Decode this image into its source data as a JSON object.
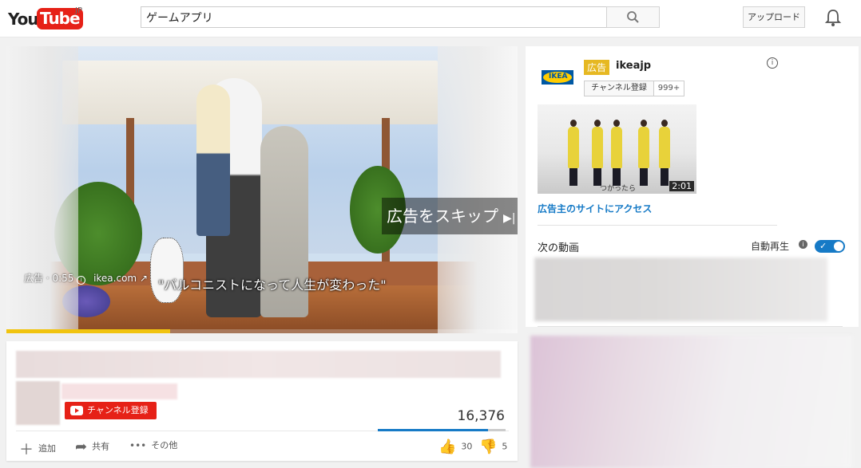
{
  "header": {
    "logo_you": "You",
    "logo_tube": "Tube",
    "logo_region": "JP",
    "search_value": "ゲームアプリ",
    "upload_label": "アップロード"
  },
  "player": {
    "skip_label": "広告をスキップ",
    "ad_time": "広告 · 0:55",
    "ad_domain": "ikea.com",
    "caption": "\"バルコニストになって人生が変わった\"",
    "progress_fraction": 0.32
  },
  "video_info": {
    "subscribe_label": "チャンネル登録",
    "view_count": "16,376",
    "like_fraction": 0.86,
    "actions": {
      "add": "追加",
      "share": "共有",
      "more": "その他"
    },
    "likes": "30",
    "dislikes": "5"
  },
  "sidebar": {
    "ad_badge": "広告",
    "advertiser": "ikeajp",
    "brand_logo_text": "IKEA",
    "subscribe_label": "チャンネル登録",
    "subscriber_count": "999+",
    "thumbnail_duration": "2:01",
    "thumbnail_caption": "つかったら",
    "visit_link": "広告主のサイトにアクセス",
    "up_next": "次の動画",
    "autoplay_label": "自動再生",
    "autoplay_on": true
  },
  "colors": {
    "brand_red": "#e62117",
    "accent_blue": "#167ac6",
    "ad_yellow": "#e6b822",
    "progress_yellow": "#f1c40f"
  }
}
